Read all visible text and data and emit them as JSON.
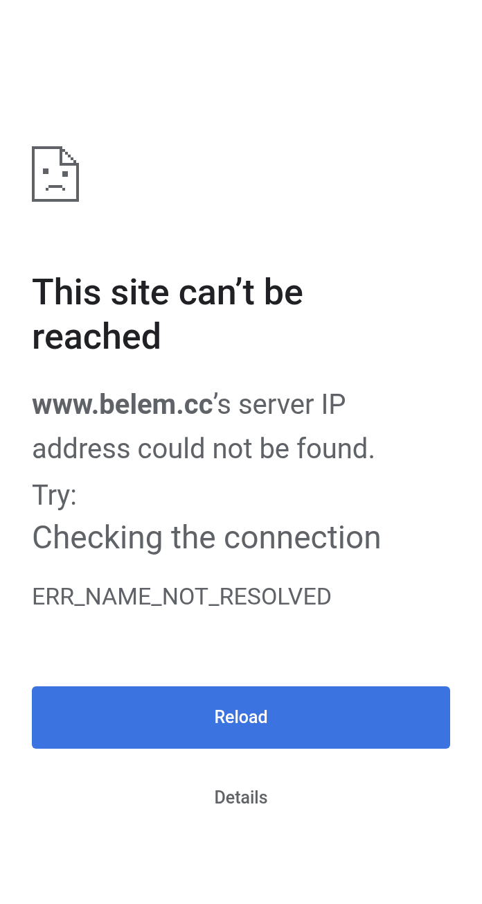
{
  "heading": "This site can’t be reached",
  "message": "**www.belem.cc**’s server IP address could not be found.",
  "try_label": "Try:",
  "suggestions": [
    "Checking the connection"
  ],
  "error_code": "ERR_NAME_NOT_RESOLVED",
  "buttons": [
    {
      "label": "Reload",
      "kind": "primary"
    },
    {
      "label": "Details",
      "kind": "link"
    }
  ]
}
